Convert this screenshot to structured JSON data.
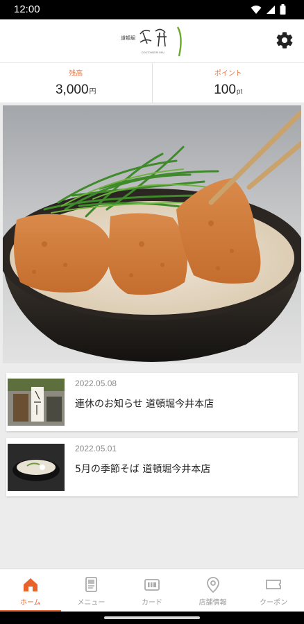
{
  "status": {
    "time": "12:00"
  },
  "header": {
    "logo_text": "道頓堀 今井"
  },
  "balance": [
    {
      "label": "残高",
      "value": "3,000",
      "unit": "円"
    },
    {
      "label": "ポイント",
      "value": "100",
      "unit": "pt"
    }
  ],
  "news": [
    {
      "date": "2022.05.08",
      "title": "連休のお知らせ 道頓堀今井本店"
    },
    {
      "date": "2022.05.01",
      "title": "5月の季節そば 道頓堀今井本店"
    }
  ],
  "nav": [
    {
      "label": "ホーム",
      "icon": "home-icon",
      "active": true
    },
    {
      "label": "メニュー",
      "icon": "menu-icon"
    },
    {
      "label": "カード",
      "icon": "card-icon"
    },
    {
      "label": "店舗情報",
      "icon": "location-icon"
    },
    {
      "label": "クーポン",
      "icon": "coupon-icon"
    }
  ],
  "colors": {
    "accent": "#e8622a",
    "label_orange": "#e87743"
  }
}
